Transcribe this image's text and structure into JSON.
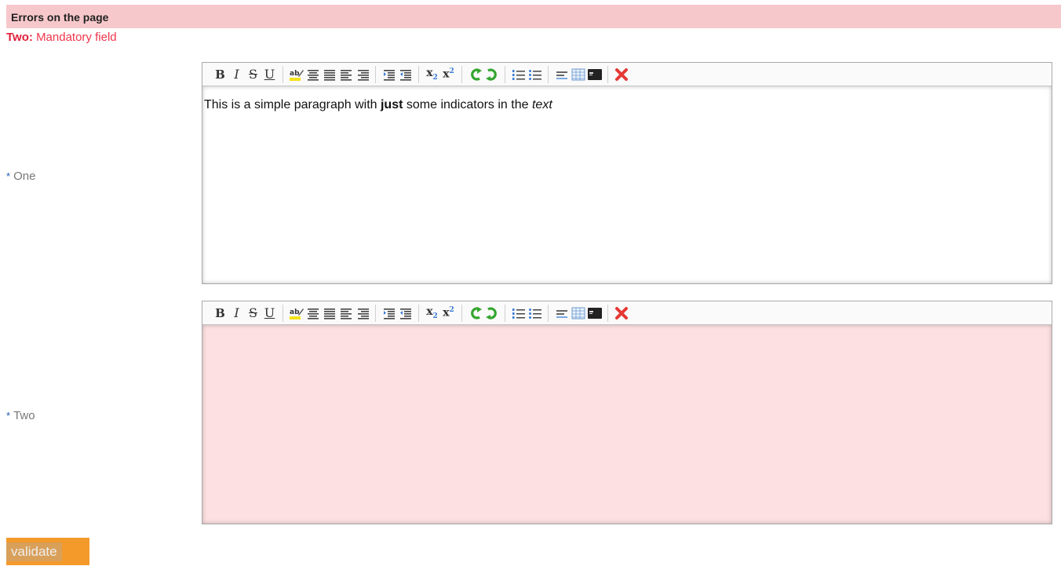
{
  "errors": {
    "banner_title": "Errors on the page",
    "items": [
      {
        "field": "Two",
        "separator": ":",
        "message": "Mandatory field"
      }
    ]
  },
  "fields": [
    {
      "label": "One",
      "required": true
    },
    {
      "label": "Two",
      "required": true
    }
  ],
  "required_marker": "*",
  "editor_one": {
    "content": {
      "before": "This is a simple paragraph with ",
      "bold": "just",
      "middle": " some indicators in the ",
      "italic": "text"
    }
  },
  "toolbar": {
    "bold": "B",
    "italic": "I",
    "strike": "S",
    "underline": "U",
    "subscript": "x",
    "subscript_sub": "2",
    "superscript": "x",
    "superscript_sup": "2",
    "icons": [
      "bold-icon",
      "italic-icon",
      "strikethrough-icon",
      "underline-icon",
      "highlight-icon",
      "align-center-icon",
      "justify-icon",
      "align-left-icon",
      "align-right-icon",
      "indent-icon",
      "outdent-icon",
      "subscript-icon",
      "superscript-icon",
      "undo-icon",
      "redo-icon",
      "ordered-list-icon",
      "unordered-list-icon",
      "horizontal-rule-icon",
      "table-icon",
      "source-code-icon",
      "remove-format-icon"
    ]
  },
  "buttons": {
    "validate": "validate"
  },
  "colors": {
    "error_banner_bg": "#f7c8cb",
    "error_text": "#f0364b",
    "error_field_bg": "#fde0e2",
    "button_bg": "#f39a2b",
    "required_marker": "#1e5bb0"
  }
}
